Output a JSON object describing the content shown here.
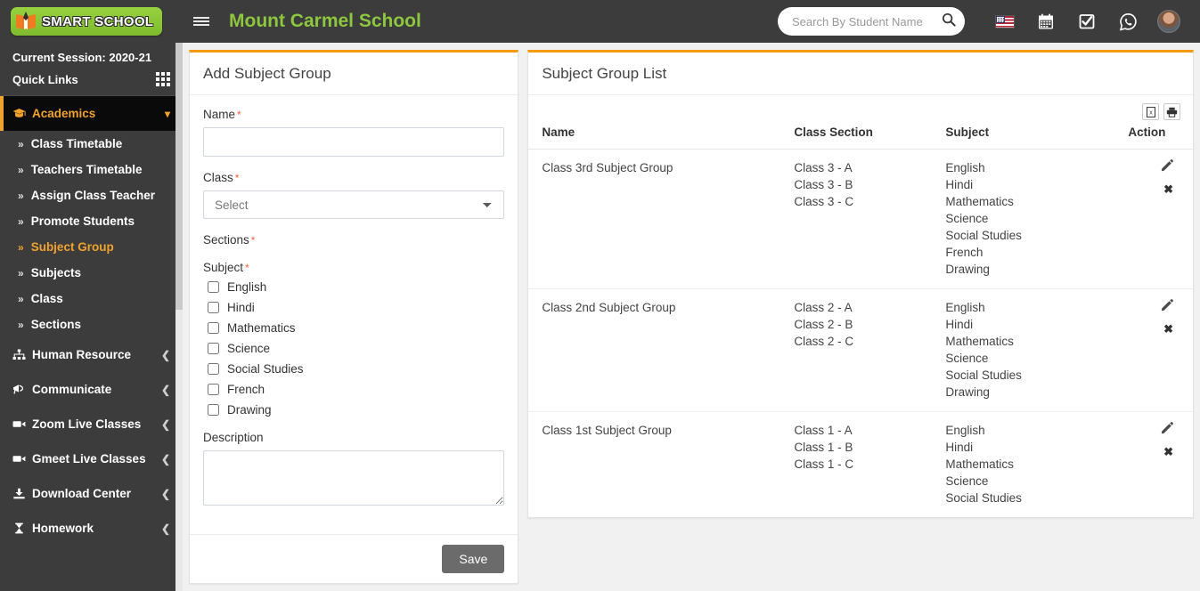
{
  "header": {
    "logo_text": "SMART SCHOOL",
    "logo_icon": "open-book-icon",
    "menu_toggle_icon": "hamburger-icon",
    "school_title": "Mount Carmel School",
    "search": {
      "placeholder": "Search By Student Name",
      "value": ""
    },
    "search_icon": "search-icon",
    "icons": [
      {
        "name": "language-flag-icon",
        "label": "US Flag"
      },
      {
        "name": "calendar-icon",
        "label": "Calendar"
      },
      {
        "name": "checkbox-task-icon",
        "label": "Tasks"
      },
      {
        "name": "whatsapp-icon",
        "label": "WhatsApp"
      },
      {
        "name": "avatar",
        "label": "Profile"
      }
    ]
  },
  "sidebar": {
    "session_label": "Current Session: 2020-21",
    "quick_links_label": "Quick Links",
    "quick_links_icon": "grid-icon",
    "active_group": {
      "label": "Academics",
      "icon": "graduation-cap-icon",
      "chevron": "chevron-down-icon",
      "items": [
        "Class Timetable",
        "Teachers Timetable",
        "Assign Class Teacher",
        "Promote Students",
        "Subject Group",
        "Subjects",
        "Class",
        "Sections"
      ],
      "active_item": "Subject Group"
    },
    "groups": [
      {
        "label": "Human Resource",
        "icon": "sitemap-icon",
        "chevron": "chevron-left-icon"
      },
      {
        "label": "Communicate",
        "icon": "bullhorn-icon",
        "chevron": "chevron-left-icon"
      },
      {
        "label": "Zoom Live Classes",
        "icon": "video-camera-icon",
        "chevron": "chevron-left-icon"
      },
      {
        "label": "Gmeet Live Classes",
        "icon": "video-camera-icon",
        "chevron": "chevron-left-icon"
      },
      {
        "label": "Download Center",
        "icon": "download-icon",
        "chevron": "chevron-left-icon"
      },
      {
        "label": "Homework",
        "icon": "homework-icon",
        "chevron": "chevron-left-icon"
      }
    ]
  },
  "form": {
    "title": "Add Subject Group",
    "name": {
      "label": "Name",
      "required": "*",
      "value": "",
      "placeholder": ""
    },
    "class": {
      "label": "Class",
      "required": "*",
      "selected": "Select",
      "options": [
        "Select"
      ]
    },
    "sections": {
      "label": "Sections",
      "required": "*"
    },
    "subject": {
      "label": "Subject",
      "required": "*",
      "options": [
        "English",
        "Hindi",
        "Mathematics",
        "Science",
        "Social Studies",
        "French",
        "Drawing"
      ]
    },
    "description": {
      "label": "Description",
      "value": "",
      "placeholder": ""
    },
    "save_label": "Save"
  },
  "list": {
    "title": "Subject Group List",
    "tools": [
      {
        "name": "export-excel-button",
        "label": "Excel"
      },
      {
        "name": "print-button",
        "label": "Print"
      }
    ],
    "columns": [
      "Name",
      "Class Section",
      "Subject",
      "Action"
    ],
    "rows": [
      {
        "name": "Class 3rd Subject Group",
        "sections": [
          "Class 3 - A",
          "Class 3 - B",
          "Class 3 - C"
        ],
        "subjects": [
          "English",
          "Hindi",
          "Mathematics",
          "Science",
          "Social Studies",
          "French",
          "Drawing"
        ],
        "actions": [
          "edit-icon",
          "delete-icon"
        ]
      },
      {
        "name": "Class 2nd Subject Group",
        "sections": [
          "Class 2 - A",
          "Class 2 - B",
          "Class 2 - C"
        ],
        "subjects": [
          "English",
          "Hindi",
          "Mathematics",
          "Science",
          "Social Studies",
          "Drawing"
        ],
        "actions": [
          "edit-icon",
          "delete-icon"
        ]
      },
      {
        "name": "Class 1st Subject Group",
        "sections": [
          "Class 1 - A",
          "Class 1 - B",
          "Class 1 - C"
        ],
        "subjects": [
          "English",
          "Hindi",
          "Mathematics",
          "Science",
          "Social Studies"
        ],
        "actions": [
          "edit-icon",
          "delete-icon"
        ]
      }
    ]
  },
  "colors": {
    "brand_green": "#8dc63f",
    "accent_orange": "#f39c12",
    "sidebar_bg": "#3c3c3c",
    "active_item": "#f0a22e",
    "required_red": "#fb6340",
    "content_bg": "#f1f1f1"
  }
}
